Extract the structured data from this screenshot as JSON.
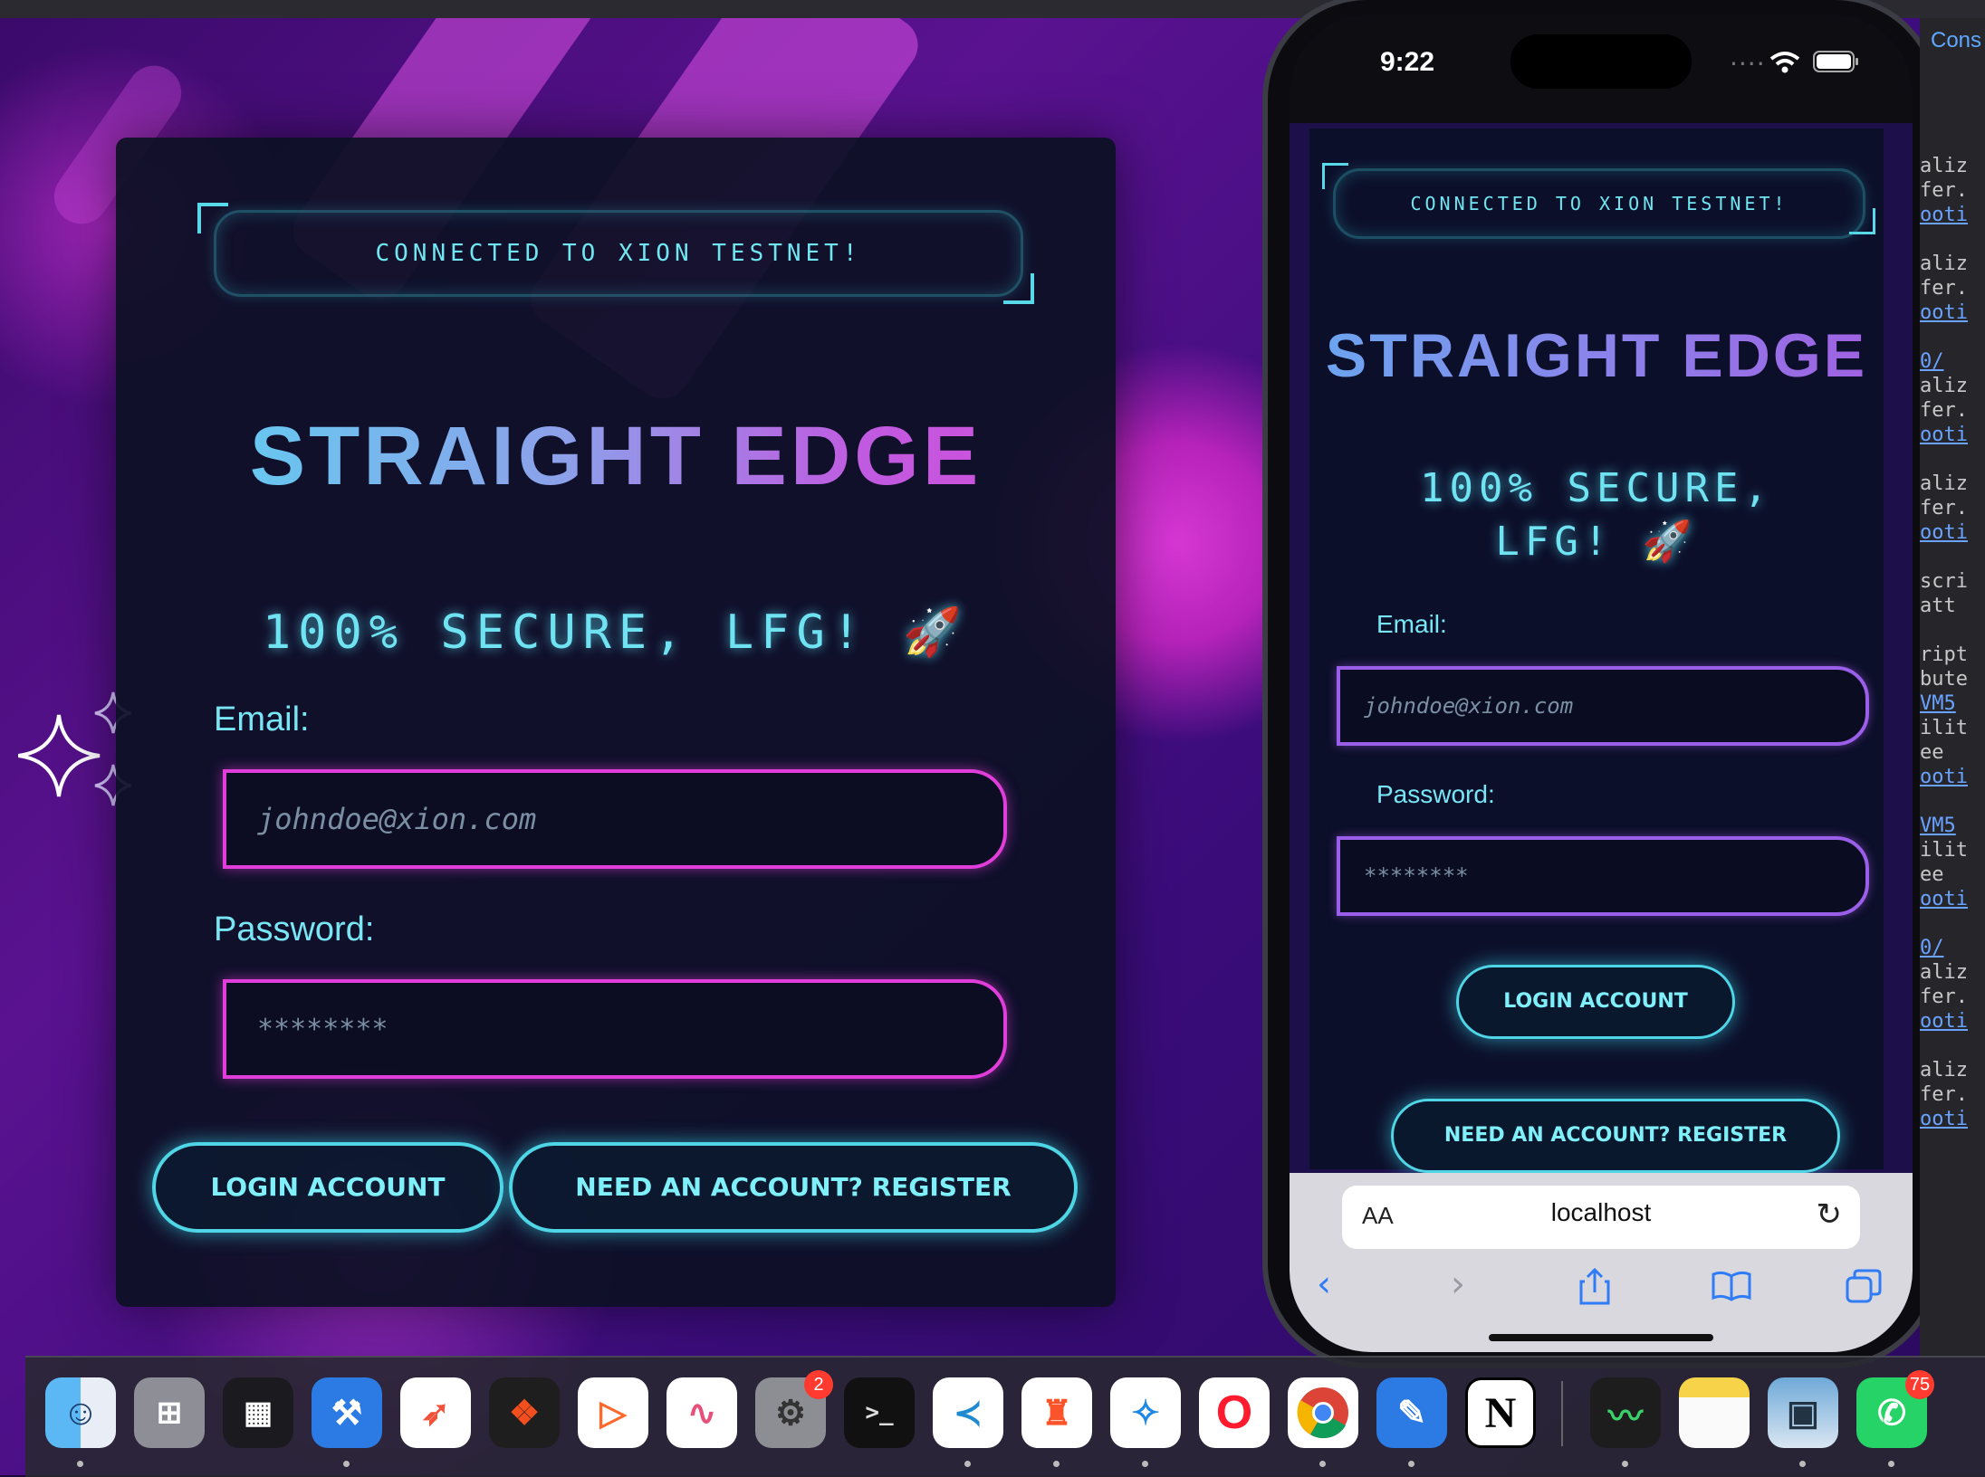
{
  "desktop": {
    "banner": "CONNECTED TO XION TESTNET!",
    "title": "STRAIGHT EDGE",
    "subtitle": "100% SECURE, LFG! 🚀",
    "email_label": "Email:",
    "email_placeholder": "johndoe@xion.com",
    "password_label": "Password:",
    "password_placeholder": "********",
    "login_button": "LOGIN ACCOUNT",
    "register_button": "NEED AN ACCOUNT? REGISTER"
  },
  "phone": {
    "time": "9:22",
    "signal": "....",
    "banner": "CONNECTED TO XION TESTNET!",
    "title": "STRAIGHT EDGE",
    "subtitle_line1": "100% SECURE,",
    "subtitle_line2": "LFG! 🚀",
    "email_label": "Email:",
    "email_placeholder": "johndoe@xion.com",
    "password_label": "Password:",
    "password_placeholder": "********",
    "login_button": "LOGIN ACCOUNT",
    "register_button": "NEED AN ACCOUNT? REGISTER",
    "safari": {
      "text_size": "AA",
      "url": "localhost"
    }
  },
  "console": {
    "tab": "Cons",
    "lines": [
      "aliz",
      "fer.",
      "ooti",
      "",
      "aliz",
      "fer.",
      "ooti",
      "",
      "0/",
      "aliz",
      "fer.",
      "ooti",
      "",
      "aliz",
      "fer.",
      "ooti",
      "",
      "scri",
      " att",
      "",
      "ript",
      "bute",
      "VM5",
      "ilit",
      "ee",
      "ooti",
      "",
      "VM5",
      "ilit",
      "ee",
      "ooti",
      "",
      "0/",
      "aliz",
      "fer.",
      "ooti",
      "",
      "aliz",
      "fer.",
      "ooti"
    ]
  },
  "dock": {
    "badges": {
      "settings": "2",
      "whatsapp": "75"
    }
  }
}
